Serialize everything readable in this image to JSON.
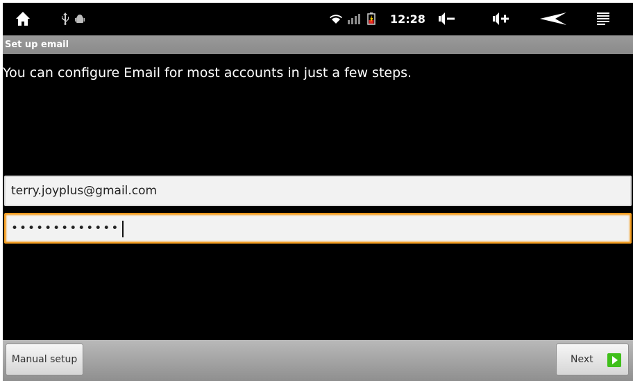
{
  "status_bar": {
    "time": "12:28",
    "icons": [
      "home-icon",
      "usb-icon",
      "android-debug-icon",
      "wifi-icon",
      "signal-icon",
      "battery-icon",
      "volume-down-icon",
      "volume-up-icon",
      "back-icon",
      "menu-icon"
    ]
  },
  "title_bar": {
    "title": "Set up email"
  },
  "main": {
    "instructions": "You can configure Email for most accounts in just a few steps."
  },
  "form": {
    "email_value": "terry.joyplus@gmail.com",
    "password_value": "•••••••••••••"
  },
  "bottom_bar": {
    "manual_setup_label": "Manual setup",
    "next_label": "Next"
  },
  "colors": {
    "focus_border": "#f39c1e",
    "next_arrow": "#3fbf1a"
  }
}
